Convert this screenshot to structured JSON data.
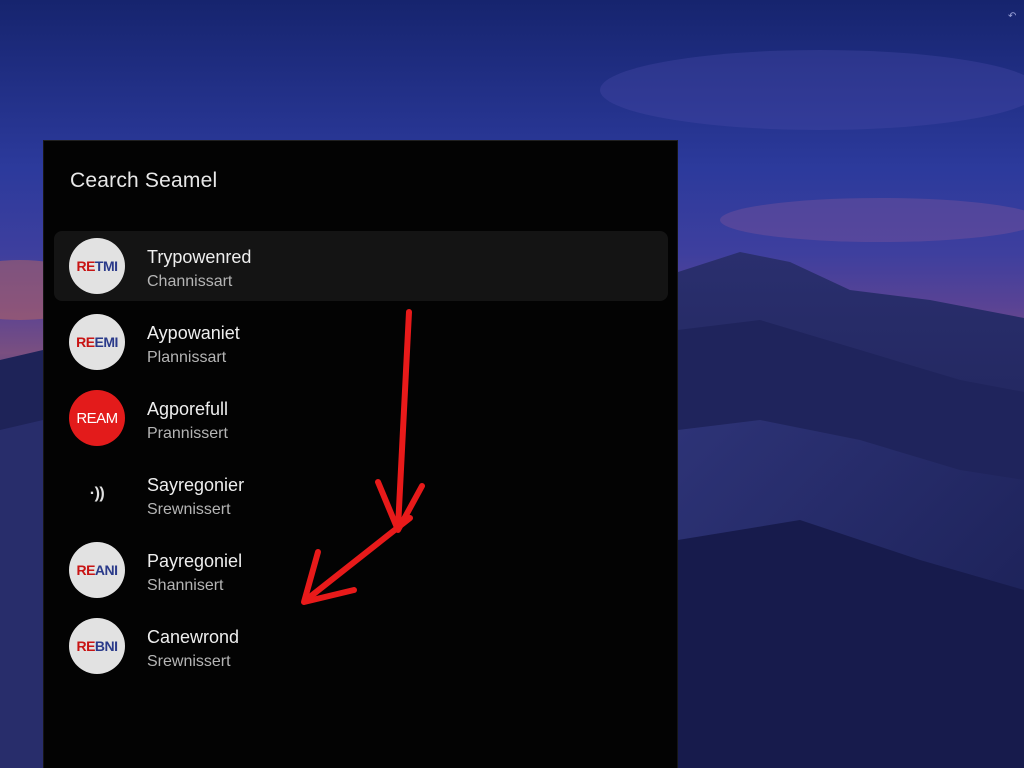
{
  "panel": {
    "title": "Cearch Seamel"
  },
  "results": [
    {
      "badge_a": "RE",
      "badge_b": "TMI",
      "badge_style": "logo",
      "title": "Trypowenred",
      "subtitle": "Channissart",
      "selected": true
    },
    {
      "badge_a": "RE",
      "badge_b": "EMI",
      "badge_style": "logo",
      "title": "Aypowaniet",
      "subtitle": "Plannissart",
      "selected": false
    },
    {
      "badge_a": "REAM",
      "badge_b": "",
      "badge_style": "red",
      "title": "Agporefull",
      "subtitle": "Prannissert",
      "selected": false
    },
    {
      "badge_a": "·))",
      "badge_b": "",
      "badge_style": "plain",
      "title": "Sayregonier",
      "subtitle": "Srewnissert",
      "selected": false
    },
    {
      "badge_a": "RE",
      "badge_b": "ANI",
      "badge_style": "logo",
      "title": "Payregoniel",
      "subtitle": "Shannisert",
      "selected": false
    },
    {
      "badge_a": "RE",
      "badge_b": "BNI",
      "badge_style": "logo",
      "title": "Canewrond",
      "subtitle": "Srewnissert",
      "selected": false
    }
  ],
  "colors": {
    "panel_bg": "#030303",
    "selected_row": "#141414",
    "annotation_arrow": "#e81a1a",
    "badge_red": "#e31b1b"
  },
  "icons": {
    "wifi_like": "signal-waves-icon",
    "corner": "swipe-corner-icon"
  }
}
